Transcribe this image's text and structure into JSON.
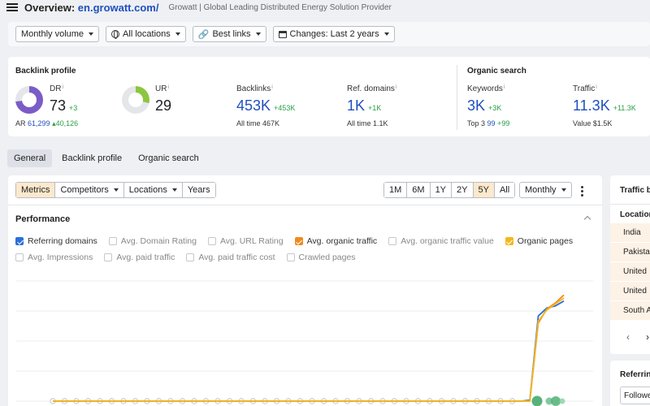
{
  "header": {
    "title_prefix": "Overview:",
    "domain": "en.growatt.com/",
    "subtitle": "Growatt | Global Leading Distributed Energy Solution Provider"
  },
  "filters": {
    "volume": "Monthly volume",
    "locations": "All locations",
    "links": "Best links",
    "changes": "Changes: Last 2 years"
  },
  "backlink_profile": {
    "title": "Backlink profile",
    "dr": {
      "label": "DR",
      "info": "i",
      "value": "73",
      "delta": "+3",
      "level": 0.73
    },
    "ar": {
      "label": "AR",
      "value": "61,299",
      "delta": "40,126"
    },
    "ur": {
      "label": "UR",
      "info": "i",
      "value": "29",
      "level": 0.29
    },
    "backlinks": {
      "label": "Backlinks",
      "info": "i",
      "value": "453K",
      "delta": "+453K",
      "sub_label": "All time",
      "sub_value": "467K"
    },
    "ref_domains": {
      "label": "Ref. domains",
      "info": "i",
      "value": "1K",
      "delta": "+1K",
      "sub_label": "All time",
      "sub_value": "1.1K"
    }
  },
  "organic_search": {
    "title": "Organic search",
    "keywords": {
      "label": "Keywords",
      "info": "i",
      "value": "3K",
      "delta": "+3K",
      "sub_label": "Top 3",
      "sub_value": "99",
      "sub_delta": "+99"
    },
    "traffic": {
      "label": "Traffic",
      "info": "i",
      "value": "11.3K",
      "delta": "+11.3K",
      "sub_label": "Value",
      "sub_value": "$1.5K"
    }
  },
  "page_tabs": [
    "General",
    "Backlink profile",
    "Organic search"
  ],
  "toolbar": {
    "metrics": "Metrics",
    "competitors": "Competitors",
    "locations": "Locations",
    "years": "Years",
    "ranges": [
      "1M",
      "6M",
      "1Y",
      "2Y",
      "5Y",
      "All"
    ],
    "active_range": "5Y",
    "interval": "Monthly"
  },
  "performance": {
    "title": "Performance",
    "checkboxes_row1": [
      {
        "label": "Referring domains",
        "checked": true,
        "color": "#2a6fdb"
      },
      {
        "label": "Avg. Domain Rating",
        "checked": false
      },
      {
        "label": "Avg. URL Rating",
        "checked": false
      },
      {
        "label": "Avg. organic traffic",
        "checked": true,
        "color": "#f08a1c"
      },
      {
        "label": "Avg. organic traffic value",
        "checked": false
      },
      {
        "label": "Organic pages",
        "checked": true,
        "color": "#f4b71d"
      }
    ],
    "checkboxes_row2": [
      {
        "label": "Avg. Impressions",
        "checked": false
      },
      {
        "label": "Avg. paid traffic",
        "checked": false
      },
      {
        "label": "Avg. paid traffic cost",
        "checked": false
      },
      {
        "label": "Crawled pages",
        "checked": false
      }
    ]
  },
  "chart_data": {
    "type": "line",
    "series": [
      {
        "color": "#2a6fdb",
        "values": [
          0,
          0,
          0,
          0,
          0,
          0,
          0,
          0,
          0,
          0,
          0,
          0,
          0,
          0,
          0,
          0,
          0,
          0,
          0,
          0,
          0,
          0,
          0,
          0,
          0,
          0,
          0,
          0,
          0,
          0,
          0,
          0,
          0,
          0,
          0,
          0,
          0,
          0,
          0,
          0,
          0,
          0,
          0,
          0,
          0,
          0,
          0,
          0,
          0,
          0,
          0,
          0,
          0,
          0,
          0,
          0,
          1,
          85,
          93,
          95,
          100
        ]
      },
      {
        "color": "#f08a1c",
        "values": [
          0,
          0,
          0,
          0,
          0,
          0,
          0,
          0,
          0,
          0,
          0,
          0,
          0,
          0,
          0,
          0,
          0,
          0,
          0,
          0,
          0,
          0,
          0,
          0,
          0,
          0,
          0,
          0,
          0,
          0,
          0,
          0,
          0,
          0,
          0,
          0,
          0,
          0,
          0,
          0,
          0,
          0,
          0,
          0,
          0,
          0,
          0,
          0,
          0,
          0,
          0,
          0,
          0,
          0,
          0,
          0,
          0,
          78,
          92,
          98,
          106
        ]
      },
      {
        "color": "#f4b71d",
        "values": [
          0,
          0,
          0,
          0,
          0,
          0,
          0,
          0,
          0,
          0,
          0,
          0,
          0,
          0,
          0,
          0,
          0,
          0,
          0,
          0,
          0,
          0,
          0,
          0,
          0,
          0,
          0,
          0,
          0,
          0,
          0,
          0,
          0,
          0,
          0,
          0,
          0,
          0,
          0,
          0,
          0,
          0,
          0,
          0,
          0,
          0,
          0,
          0,
          0,
          0,
          0,
          0,
          0,
          0,
          0,
          0,
          0,
          80,
          91,
          97,
          103
        ]
      }
    ],
    "ylim": [
      0,
      120
    ],
    "grid": true
  },
  "traffic_panel": {
    "title": "Traffic b",
    "location_header": "Location",
    "rows": [
      "India",
      "Pakista",
      "United",
      "United",
      "South A"
    ]
  },
  "referring_panel": {
    "title": "Referrin",
    "first": "Followe"
  },
  "icons": {
    "menu": "hamburger-icon",
    "globe": "globe-icon",
    "link": "link-icon",
    "calendar": "calendar-icon"
  }
}
